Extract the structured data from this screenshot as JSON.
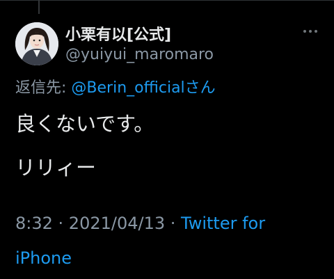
{
  "author": {
    "display_name": "小栗有以[公式]",
    "handle": "@yuiyui_maromaro"
  },
  "reply": {
    "prefix": "返信先: ",
    "mention": "@Berin_official",
    "suffix": "さん"
  },
  "tweet": {
    "line1": "良くないです。",
    "line2": "リリィー"
  },
  "meta": {
    "time": "8:32",
    "separator": " · ",
    "date": "2021/04/13",
    "source": "Twitter for iPhone"
  },
  "colors": {
    "background": "#000000",
    "text": "#e7e9ea",
    "secondary": "#8b98a5",
    "link": "#1d9bf0"
  },
  "icons": {
    "more": "more-dots-icon"
  }
}
